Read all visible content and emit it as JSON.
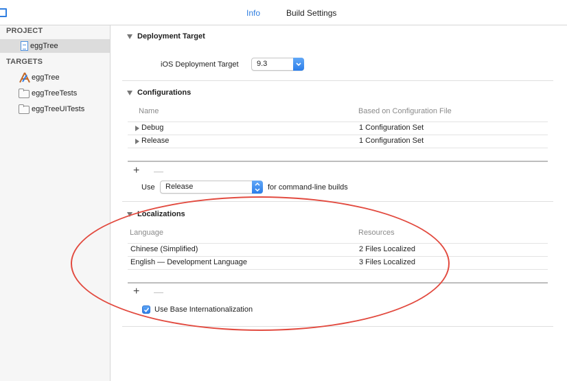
{
  "tabs": {
    "info": "Info",
    "build_settings": "Build Settings"
  },
  "sidebar": {
    "project_header": "PROJECT",
    "project_items": [
      {
        "label": "eggTree",
        "icon": "project-document-icon"
      }
    ],
    "targets_header": "TARGETS",
    "target_items": [
      {
        "label": "eggTree",
        "icon": "app-target-icon"
      },
      {
        "label": "eggTreeTests",
        "icon": "folder-icon"
      },
      {
        "label": "eggTreeUITests",
        "icon": "folder-icon"
      }
    ]
  },
  "deployment": {
    "title": "Deployment Target",
    "ios_label": "iOS Deployment Target",
    "ios_value": "9.3"
  },
  "configurations": {
    "title": "Configurations",
    "columns": [
      "Name",
      "Based on Configuration File"
    ],
    "rows": [
      {
        "name": "Debug",
        "based_on": "1 Configuration Set"
      },
      {
        "name": "Release",
        "based_on": "1 Configuration Set"
      }
    ],
    "use_label": "Use",
    "use_value": "Release",
    "use_suffix": "for command-line builds"
  },
  "localizations": {
    "title": "Localizations",
    "columns": [
      "Language",
      "Resources"
    ],
    "rows": [
      {
        "language": "Chinese (Simplified)",
        "resources": "2 Files Localized"
      },
      {
        "language": "English — Development Language",
        "resources": "3 Files Localized"
      }
    ],
    "use_base_label": "Use Base Internationalization",
    "use_base_checked": true
  },
  "controls": {
    "plus": "+",
    "minus": "—"
  },
  "colors": {
    "accent": "#2f7ee0",
    "annotation": "#e24a3f",
    "selection": "#dcdcdc"
  }
}
